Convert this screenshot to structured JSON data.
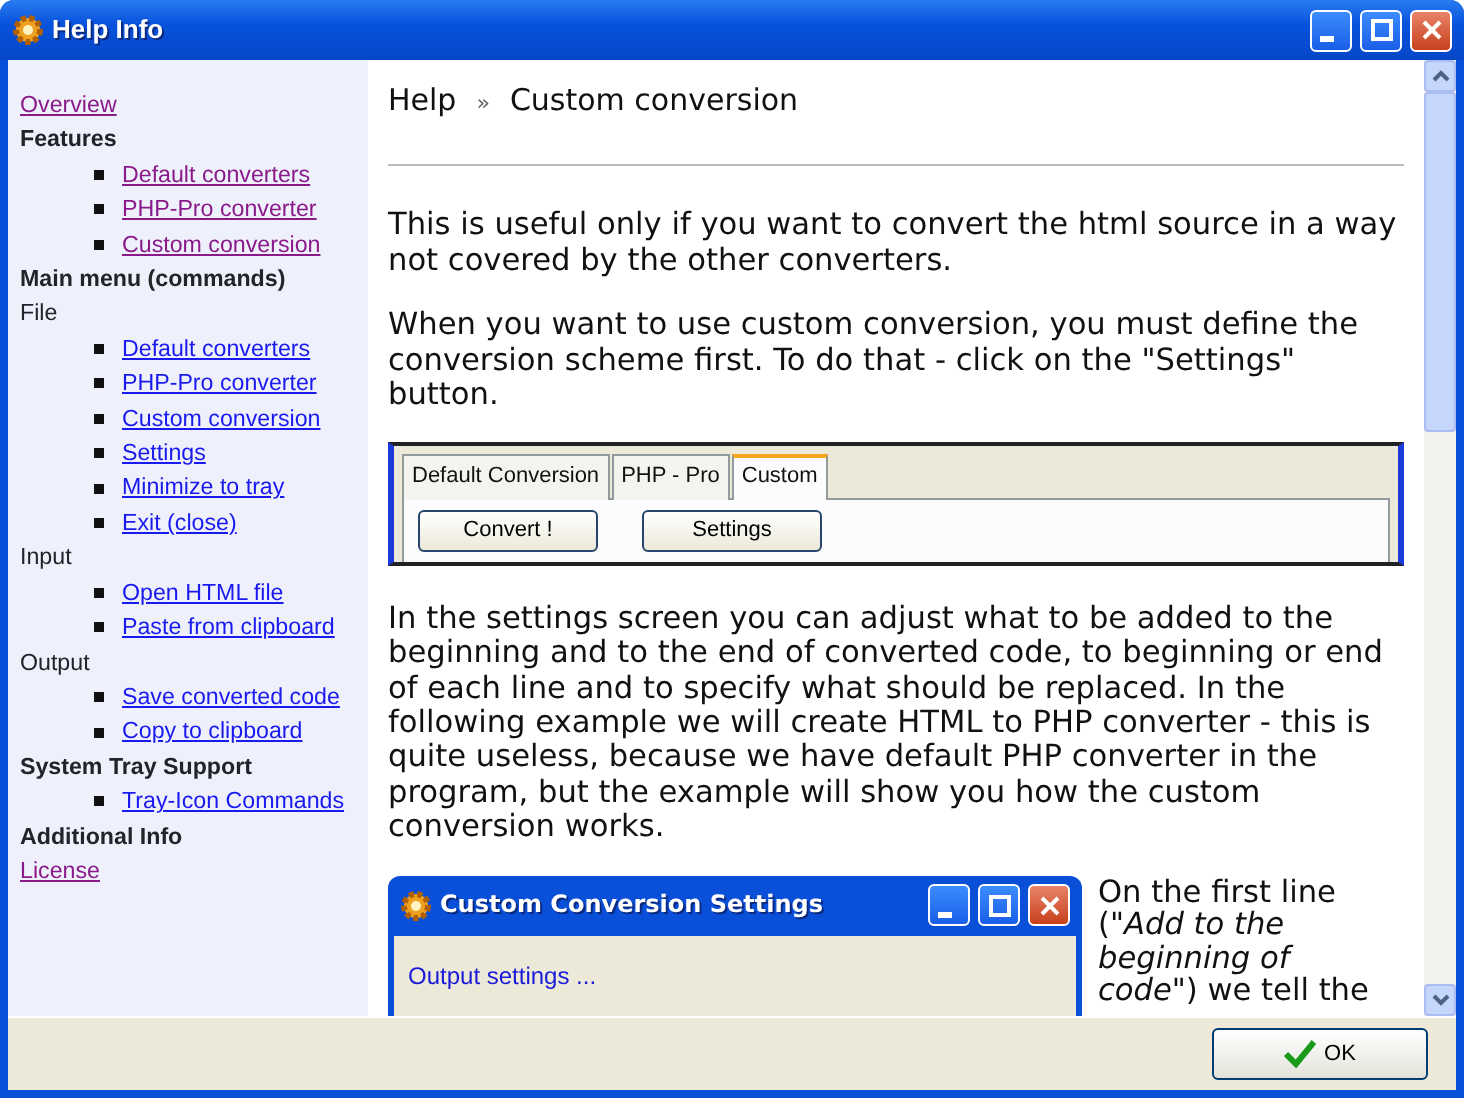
{
  "window": {
    "title": "Help Info",
    "buttons": [
      {
        "kind": "minimize"
      },
      {
        "kind": "maximize"
      },
      {
        "kind": "close"
      }
    ]
  },
  "sidebar": [
    {
      "label": "Overview",
      "kind": "link",
      "visited": true
    },
    {
      "label": "Features",
      "kind": "heading",
      "children": [
        {
          "label": "Default converters",
          "visited": true
        },
        {
          "label": "PHP-Pro converter",
          "visited": true
        },
        {
          "label": "Custom conversion",
          "visited": true
        }
      ]
    },
    {
      "label": "Main menu (commands)",
      "kind": "heading"
    },
    {
      "label": "File",
      "kind": "group",
      "children": [
        {
          "label": "Default converters",
          "visited": false
        },
        {
          "label": "PHP-Pro converter",
          "visited": false
        },
        {
          "label": "Custom conversion",
          "visited": false
        },
        {
          "label": "Settings",
          "visited": false
        },
        {
          "label": "Minimize to tray",
          "visited": false
        },
        {
          "label": "Exit (close)",
          "visited": false
        }
      ]
    },
    {
      "label": "Input",
      "kind": "group",
      "children": [
        {
          "label": "Open HTML file",
          "visited": false
        },
        {
          "label": "Paste from clipboard",
          "visited": false
        }
      ]
    },
    {
      "label": "Output",
      "kind": "group",
      "children": [
        {
          "label": "Save converted code",
          "visited": false
        },
        {
          "label": "Copy to clipboard",
          "visited": false
        }
      ]
    },
    {
      "label": "System Tray Support",
      "kind": "heading",
      "children": [
        {
          "label": "Tray-Icon Commands",
          "visited": false
        }
      ]
    },
    {
      "label": "Additional Info",
      "kind": "heading"
    },
    {
      "label": "License",
      "kind": "link",
      "visited": true
    }
  ],
  "breadcrumb": {
    "root": "Help",
    "separator": "»",
    "current": "Custom conversion"
  },
  "content": [
    {
      "kind": "text",
      "text": "This is useful only if you want to convert the html source in a way not covered by the other converters."
    },
    {
      "kind": "text",
      "text": "When you want to use custom conversion, you must define the conversion scheme first. To do that - click on the \"Settings\" button."
    },
    {
      "kind": "tabs_shot",
      "tabs": [
        {
          "label": "Default Conversion",
          "selected": false
        },
        {
          "label": "PHP - Pro",
          "selected": false
        },
        {
          "label": "Custom",
          "selected": true
        }
      ],
      "buttons": [
        "Convert !",
        "Settings"
      ]
    },
    {
      "kind": "text",
      "text": "In the settings screen you can adjust what to be added to the beginning and to the end of converted code, to beginning or end of each line and to specify what should be replaced. In the following example we will create HTML to PHP converter - this is quite useless, because we have default PHP converter in the program, but the example will show you how the custom conversion works."
    },
    {
      "kind": "dialog_shot",
      "title": "Custom Conversion Settings",
      "body": "Output settings ...",
      "text": "On the first line (\"*Add to the beginning of code*\") we tell the"
    }
  ],
  "footer": {
    "button": "OK"
  }
}
